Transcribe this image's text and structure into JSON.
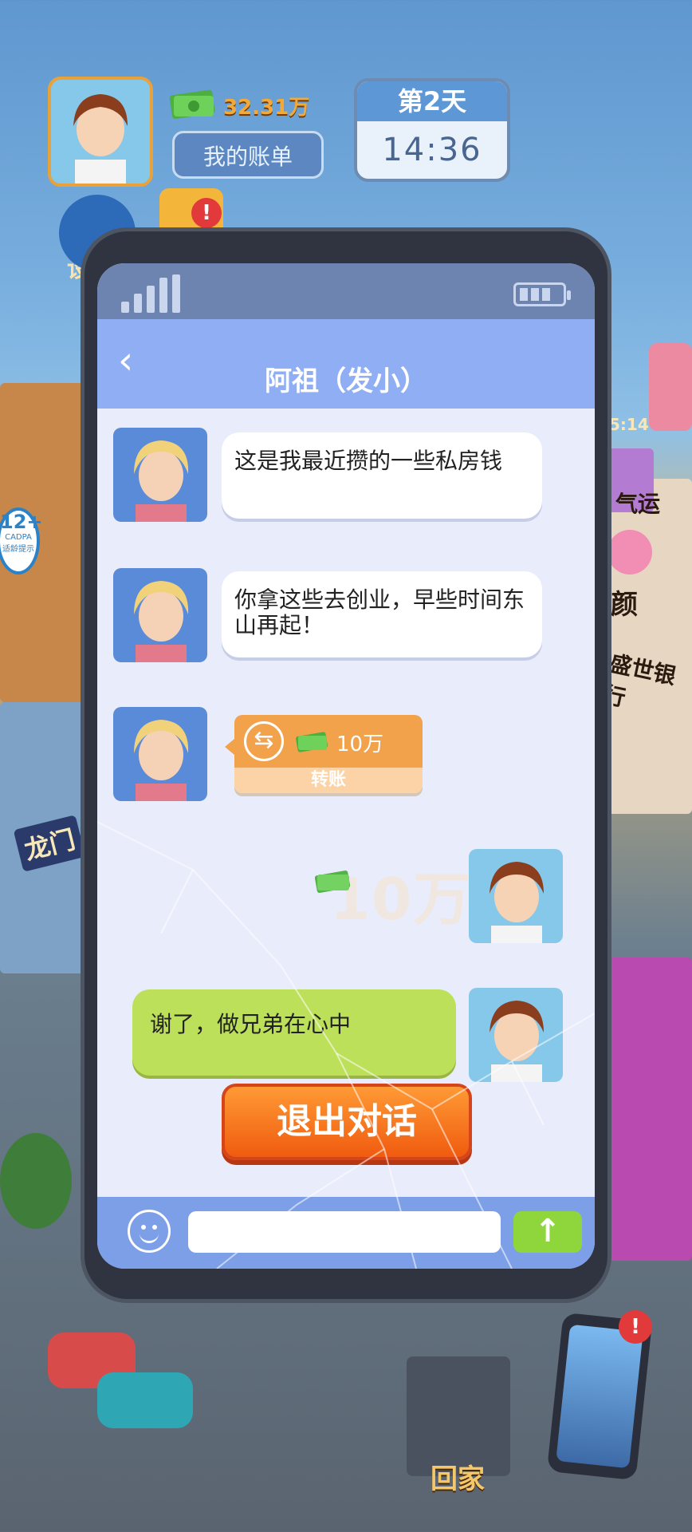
{
  "hud": {
    "money": "32.31万",
    "bill_button": "我的账单",
    "day": "第2天",
    "time": "14:36"
  },
  "side": {
    "settings_partial": "设",
    "timer": "5:14",
    "luck_label": "气运",
    "beauty_label": "颜",
    "bank_sign": "盛世银行",
    "shop_sign": "龙门",
    "age_badge": "12+",
    "age_sub": "CADPA",
    "age_tip": "适龄提示",
    "home_label": "回家",
    "notif_mark": "!"
  },
  "chat": {
    "title": "阿祖（发小）",
    "messages": [
      {
        "text": "这是我最近攒的一些私房钱"
      },
      {
        "text": "你拿这些去创业，早些时间东山再起！"
      }
    ],
    "transfer_amount": "10万",
    "transfer_label": "转账",
    "ghost_amount": "10万",
    "reply": "谢了，做兄弟在心中",
    "exit_button": "退出对话",
    "input_placeholder": "",
    "send_symbol": "↑"
  }
}
